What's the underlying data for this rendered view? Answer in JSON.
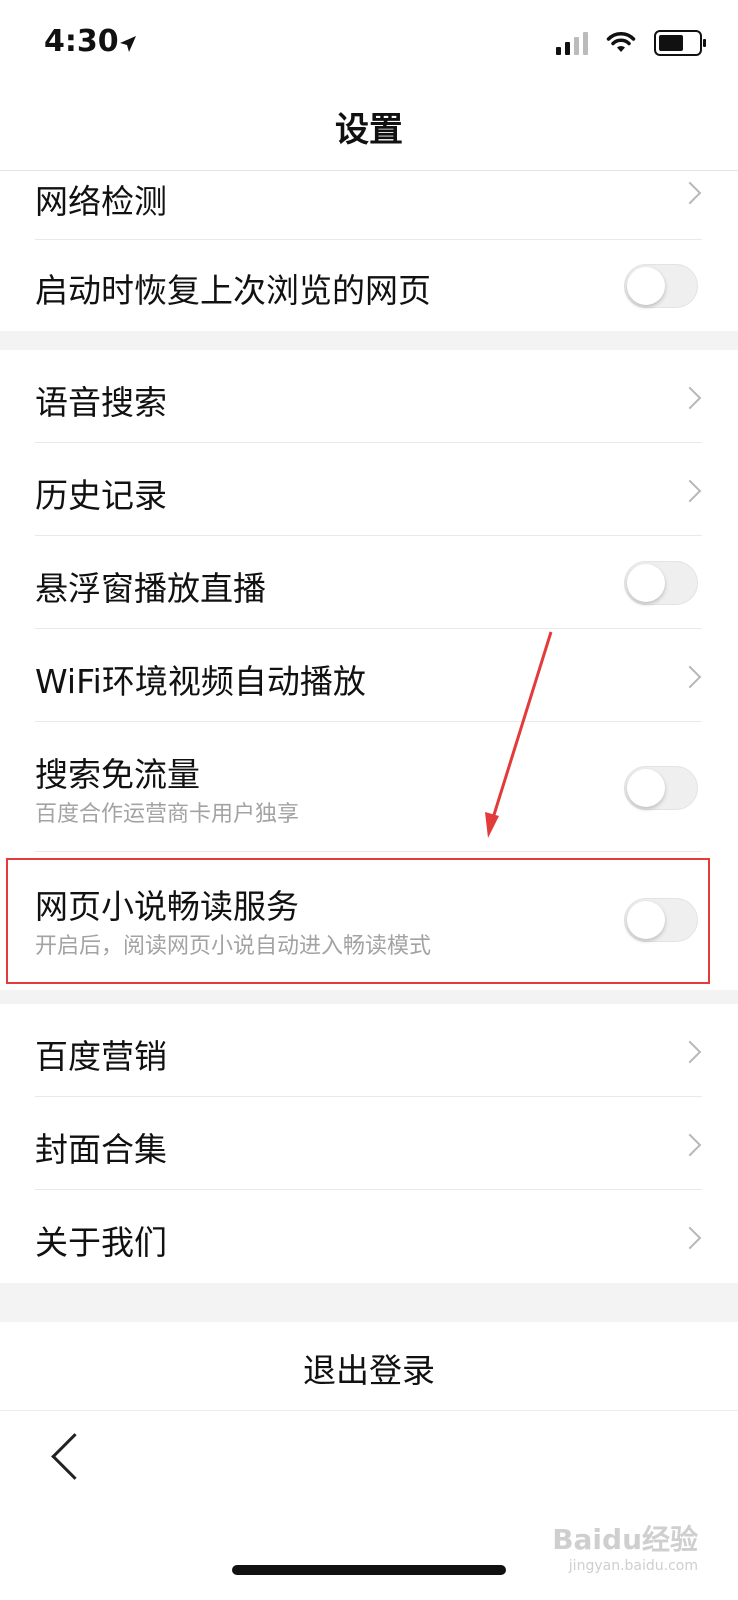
{
  "status_bar": {
    "time": "4:30",
    "icons": [
      "location-arrow-icon",
      "cellular-signal-icon",
      "wifi-icon",
      "battery-icon"
    ]
  },
  "nav": {
    "title": "设置"
  },
  "rows": [
    {
      "label": "网络检测",
      "control": "chevron"
    },
    {
      "label": "启动时恢复上次浏览的网页",
      "control": "toggle",
      "on": false
    },
    {
      "label": "语音搜索",
      "control": "chevron"
    },
    {
      "label": "历史记录",
      "control": "chevron"
    },
    {
      "label": "悬浮窗播放直播",
      "control": "toggle",
      "on": false
    },
    {
      "label": "WiFi环境视频自动播放",
      "control": "chevron"
    },
    {
      "label": "搜索免流量",
      "sub": "百度合作运营商卡用户独享",
      "control": "toggle",
      "on": false
    },
    {
      "label": "网页小说畅读服务",
      "sub": "开启后，阅读网页小说自动进入畅读模式",
      "control": "toggle",
      "on": false
    },
    {
      "label": "百度营销",
      "control": "chevron"
    },
    {
      "label": "封面合集",
      "control": "chevron"
    },
    {
      "label": "关于我们",
      "control": "chevron"
    }
  ],
  "logout": {
    "label": "退出登录"
  },
  "watermark": {
    "main": "Baidu经验",
    "sub": "jingyan.baidu.com"
  },
  "colors": {
    "highlight": "#e33a3a",
    "toggle_off": "#efefef",
    "chevron": "#b8b8b8"
  }
}
